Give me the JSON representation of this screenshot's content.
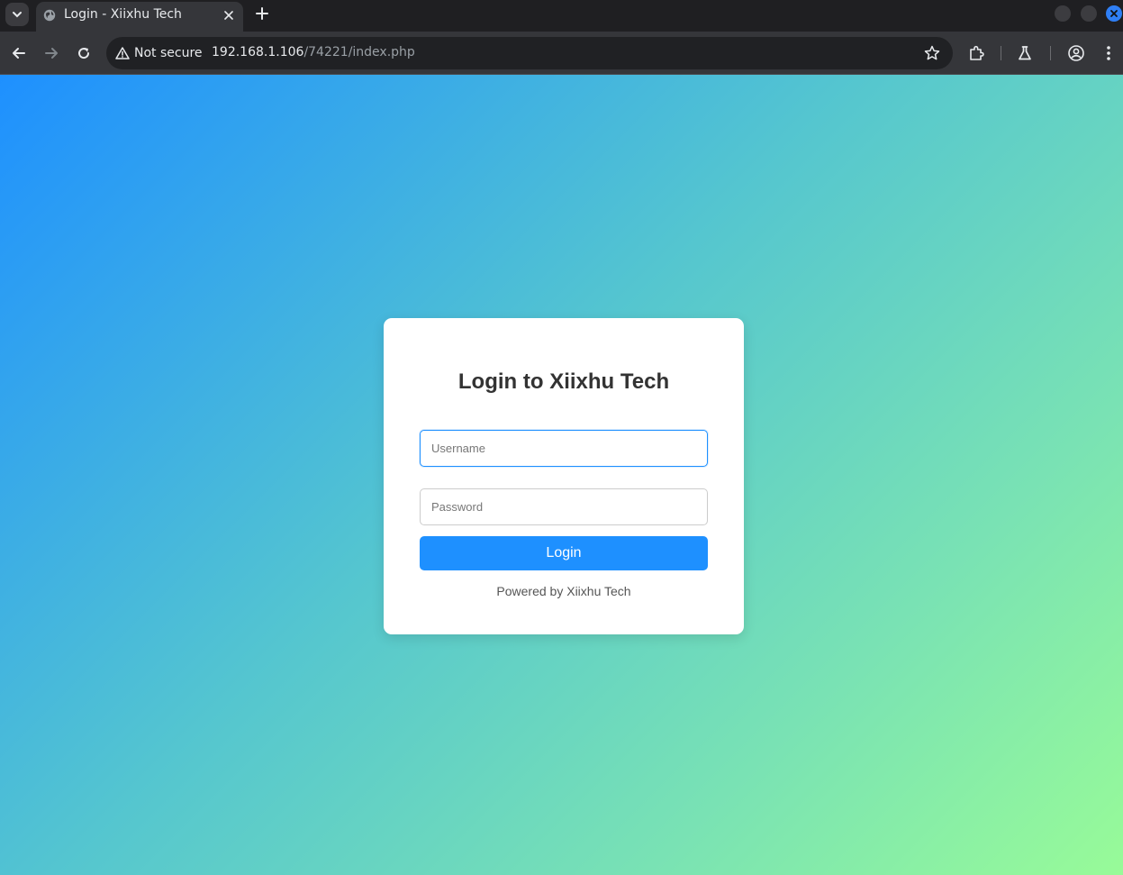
{
  "browser": {
    "tab": {
      "title": "Login - Xiixhu Tech"
    },
    "address_bar": {
      "security_label": "Not secure",
      "url_host": "192.168.1.106",
      "url_path": "/74221/index.php"
    },
    "colors": {
      "chrome_dark": "#202124",
      "toolbar": "#35363a",
      "close_accent": "#2f7ff5"
    }
  },
  "page": {
    "colors": {
      "gradient_start": "#1e90ff",
      "gradient_end": "#98fb98",
      "accent": "#1e90ff",
      "card": "#ffffff"
    },
    "login_card": {
      "title": "Login to Xiixhu Tech",
      "username_placeholder": "Username",
      "password_placeholder": "Password",
      "submit_label": "Login",
      "footer": "Powered by Xiixhu Tech"
    }
  }
}
